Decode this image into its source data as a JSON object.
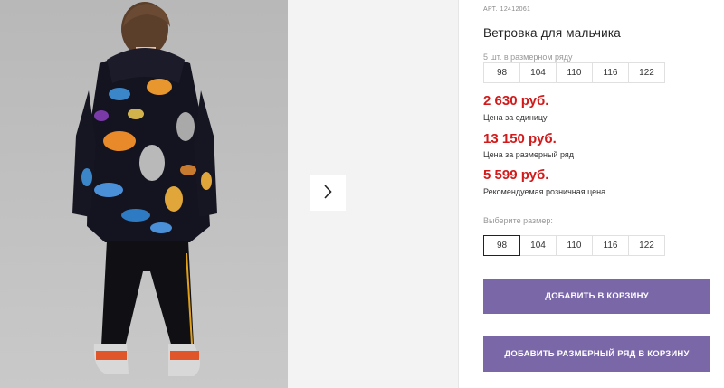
{
  "product": {
    "article_label": "АРТ.",
    "article_number": "12412061",
    "title": "Ветровка для мальчика",
    "pack_note": "5 шт. в размерном ряду",
    "pack_sizes": [
      "98",
      "104",
      "110",
      "116",
      "122"
    ]
  },
  "prices": {
    "unit_price": "2 630 руб.",
    "unit_price_label": "Цена за единицу",
    "pack_price": "13 150 руб.",
    "pack_price_label": "Цена за размерный ряд",
    "retail_price": "5 599 руб.",
    "retail_price_label": "Рекомендуемая розничная цена"
  },
  "size_select": {
    "label": "Выберите размер:",
    "options": [
      "98",
      "104",
      "110",
      "116",
      "122"
    ],
    "selected": "98"
  },
  "actions": {
    "add_to_cart": "ДОБАВИТЬ В КОРЗИНУ",
    "add_pack_to_cart": "ДОБАВИТЬ РАЗМЕРНЫЙ РЯД В КОРЗИНУ"
  },
  "gallery": {
    "next_icon": "chevron-right-icon"
  },
  "colors": {
    "price_red": "#d31a1a",
    "button_purple": "#7a67a8",
    "selected_border": "#222222"
  }
}
